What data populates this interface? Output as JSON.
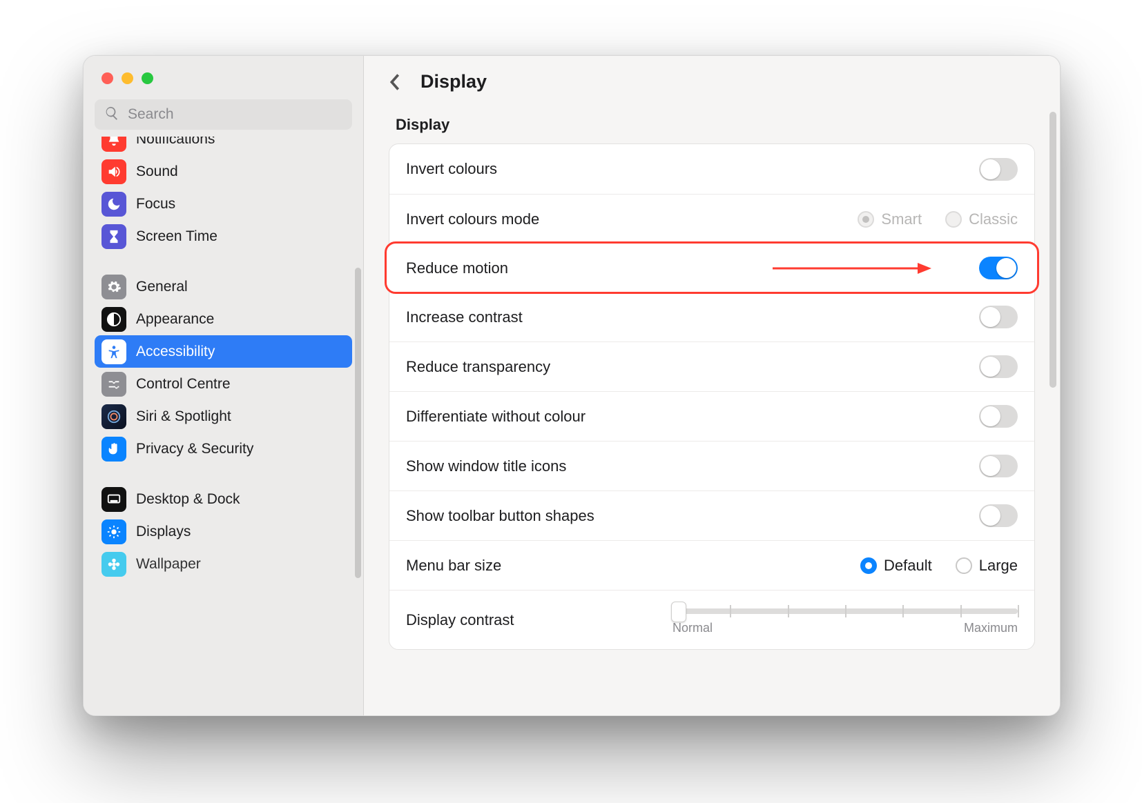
{
  "search": {
    "placeholder": "Search"
  },
  "sidebar": {
    "items": [
      {
        "id": "notifications",
        "label": "Notifications",
        "icon": "bell"
      },
      {
        "id": "sound",
        "label": "Sound",
        "icon": "speaker"
      },
      {
        "id": "focus",
        "label": "Focus",
        "icon": "moon"
      },
      {
        "id": "screentime",
        "label": "Screen Time",
        "icon": "hourglass"
      },
      {
        "id": "general",
        "label": "General",
        "icon": "gear"
      },
      {
        "id": "appearance",
        "label": "Appearance",
        "icon": "contrast"
      },
      {
        "id": "accessibility",
        "label": "Accessibility",
        "icon": "person",
        "selected": true
      },
      {
        "id": "controlcentre",
        "label": "Control Centre",
        "icon": "sliders"
      },
      {
        "id": "siri",
        "label": "Siri & Spotlight",
        "icon": "siri"
      },
      {
        "id": "privacy",
        "label": "Privacy & Security",
        "icon": "hand"
      },
      {
        "id": "desktopdock",
        "label": "Desktop & Dock",
        "icon": "dock"
      },
      {
        "id": "displays",
        "label": "Displays",
        "icon": "brightness"
      },
      {
        "id": "wallpaper",
        "label": "Wallpaper",
        "icon": "flower"
      }
    ]
  },
  "header": {
    "title": "Display"
  },
  "section": {
    "heading": "Display"
  },
  "rows": {
    "invert_colours": {
      "label": "Invert colours",
      "value": false
    },
    "invert_mode": {
      "label": "Invert colours mode",
      "options": {
        "smart": "Smart",
        "classic": "Classic"
      },
      "selected": "smart",
      "enabled": false
    },
    "reduce_motion": {
      "label": "Reduce motion",
      "value": true,
      "highlighted": true
    },
    "increase_contrast": {
      "label": "Increase contrast",
      "value": false
    },
    "reduce_transparency": {
      "label": "Reduce transparency",
      "value": false
    },
    "diff_without_colour": {
      "label": "Differentiate without colour",
      "value": false
    },
    "show_title_icons": {
      "label": "Show window title icons",
      "value": false
    },
    "show_toolbar_shapes": {
      "label": "Show toolbar button shapes",
      "value": false
    },
    "menu_bar_size": {
      "label": "Menu bar size",
      "options": {
        "default": "Default",
        "large": "Large"
      },
      "selected": "default"
    },
    "display_contrast": {
      "label": "Display contrast",
      "min_label": "Normal",
      "max_label": "Maximum"
    }
  }
}
